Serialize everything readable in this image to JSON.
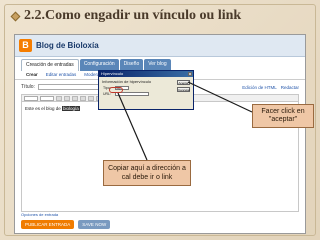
{
  "slide": {
    "title": "2.2.Como engadir un vínculo ou link"
  },
  "blogger": {
    "blog_title": "Blog de Bioloxía",
    "tabs": [
      "Creación de entradas",
      "Configuración",
      "Diseño",
      "Ver blog"
    ],
    "subtabs": [
      "Crear",
      "Editar entradas",
      "Moderar comentarios"
    ],
    "title_label": "Título:",
    "edit_links": [
      "Edición de HTML",
      "Redactar"
    ],
    "editor_text": "Este es el blog de",
    "editor_highlight": "biología"
  },
  "dialog": {
    "title": "Hipervínculo",
    "legend": "Información de hipervínculo",
    "url_label": "URL:",
    "type_label": "Tipo:",
    "type_value": "http:",
    "ok_label": "Aceptar",
    "cancel_label": "Cancelar"
  },
  "callouts": {
    "accept": "Facer click en \"aceptar\"",
    "url": "Copiar aquí a dirección a cal debe ir o link"
  },
  "footer": {
    "options": "Opciones de entrada",
    "publish": "PUBLICAR ENTRADA",
    "save": "SAVE NOW"
  }
}
